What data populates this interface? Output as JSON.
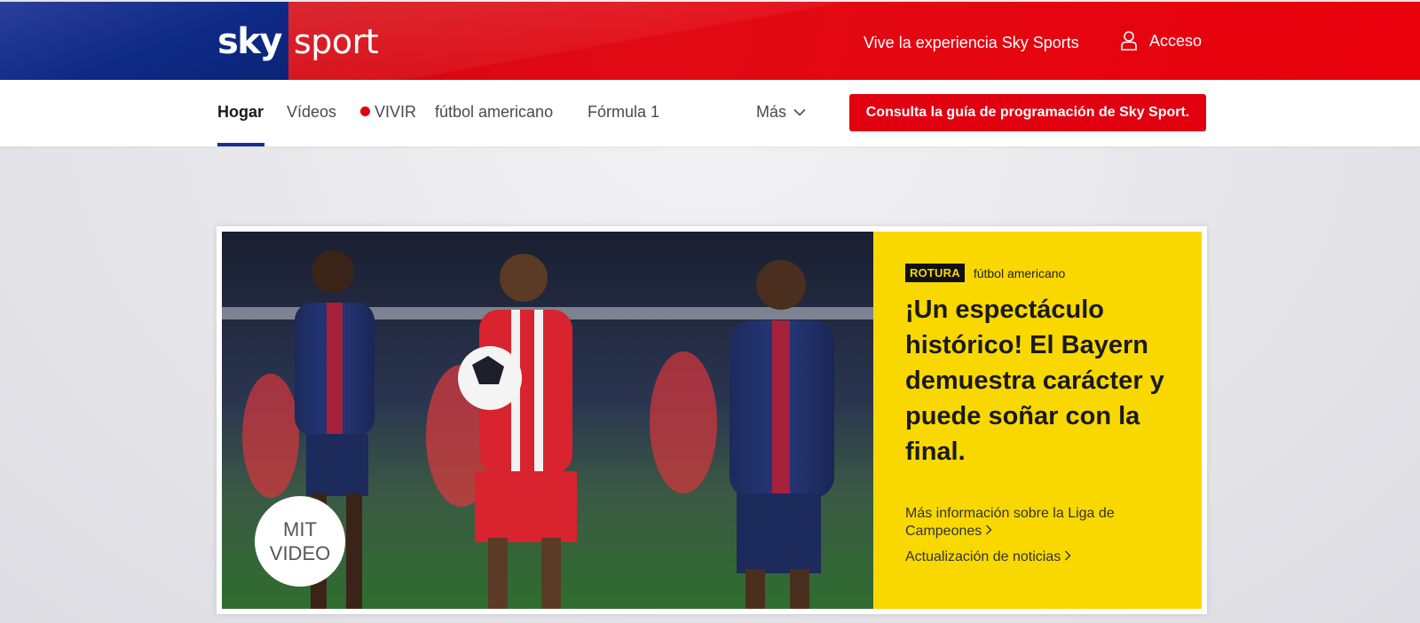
{
  "header": {
    "logo_sky": "sky",
    "logo_sport": "sport",
    "experience_link": "Vive la experiencia Sky Sports",
    "login_label": "Acceso",
    "colors": {
      "red": "#e1000f",
      "blue": "#0f2a86"
    }
  },
  "nav": {
    "items": [
      {
        "label": "Hogar",
        "active": true
      },
      {
        "label": "Vídeos"
      },
      {
        "label": "VIVIR",
        "live": true
      },
      {
        "label": "fútbol americano"
      },
      {
        "label": "Fórmula 1"
      }
    ],
    "more_label": "Más",
    "guide_button": "Consulta la guía de programación de Sky Sport."
  },
  "hero": {
    "video_badge": "MIT VIDEO",
    "badge": "ROTURA",
    "category": "fútbol americano",
    "headline": "¡Un espectáculo histórico! El Bayern demuestra carácter y puede soñar con la final.",
    "links": [
      "Más información sobre la Liga de Campeones",
      "Actualización de noticias"
    ],
    "panel_color": "#f9d800",
    "image_alt": "Match photo: Bayern player in red with the ball between two PSG players in navy kits"
  }
}
